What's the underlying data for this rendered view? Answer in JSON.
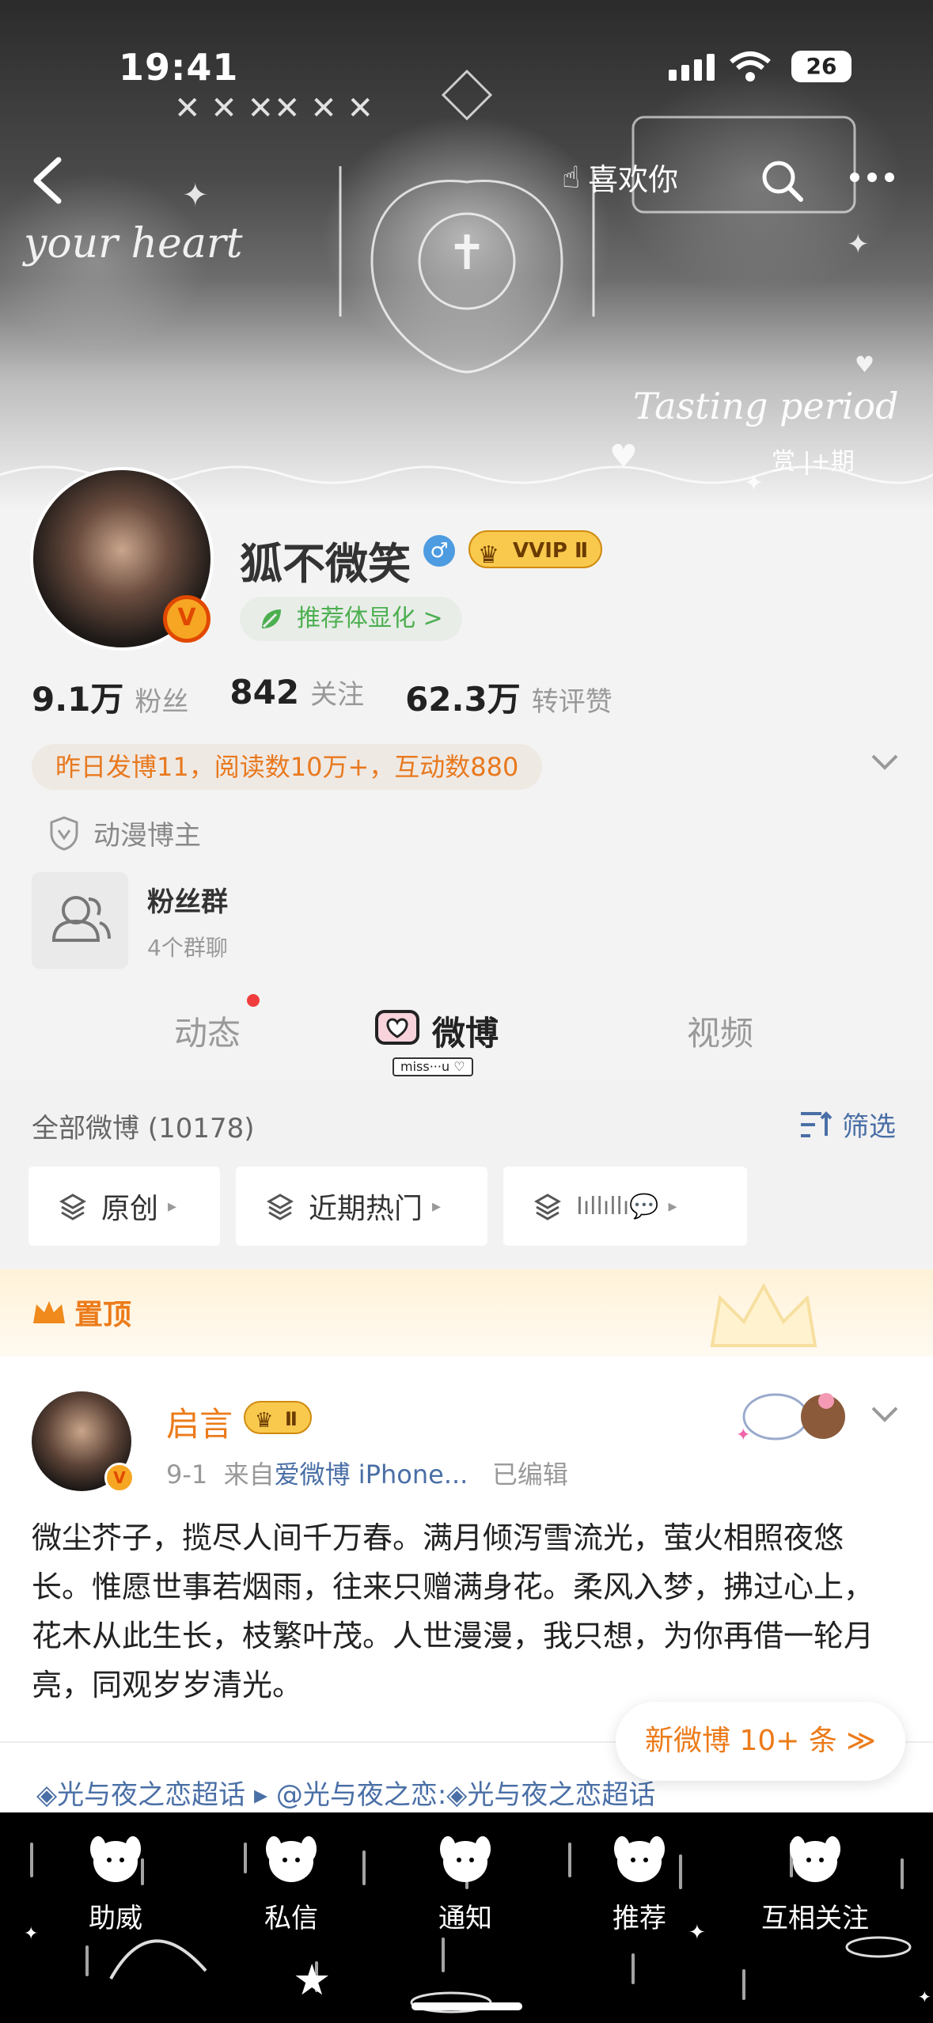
{
  "status_bar": {
    "time": "19:41",
    "battery": "26"
  },
  "header": {
    "like_label": "喜欢你",
    "banner_text_left": "your heart",
    "banner_text_right": "Tasting period",
    "banner_corner": "赏   |+期"
  },
  "profile": {
    "name": "狐不微笑",
    "gender_icon": "♂",
    "vvip": "VVIP Ⅱ",
    "recommend": "推荐体显化 >",
    "stats": [
      {
        "value": "9.1万",
        "label": "粉丝"
      },
      {
        "value": "842",
        "label": "关注"
      },
      {
        "value": "62.3万",
        "label": "转评赞"
      }
    ],
    "daily_summary": "昨日发博11，阅读数10万+，互动数880",
    "certification": "动漫博主",
    "fan_group": {
      "title": "粉丝群",
      "subtitle": "4个群聊"
    }
  },
  "tabs": [
    {
      "label": "动态",
      "active": false
    },
    {
      "label": "微博",
      "active": true
    },
    {
      "label": "视频",
      "active": false
    }
  ],
  "tab_sticker": "miss···u ♡",
  "list": {
    "all_count": "全部微博 (10178)",
    "filter_label": "筛选",
    "chips": [
      "原创",
      "近期热门",
      "Ⅰıllıllı💬"
    ]
  },
  "pinned_label": "置顶",
  "post": {
    "author": "启言",
    "badge": "Ⅱ",
    "date": "9-1",
    "source_prefix": "来自",
    "source": "爱微博 iPhone...",
    "edited": "已编辑",
    "body": "微尘芥子，揽尽人间千万春。满月倾泻雪流光，萤火相照夜悠长。惟愿世事若烟雨，往来只赠满身花。柔风入梦，拂过心上，花木从此生长，枝繁叶茂。人世漫漫，我只想，为你再借一轮月亮，同观岁岁清光。"
  },
  "new_posts_pill": "新微博 10+ 条 ≫",
  "topics": "◈光与夜之恋超话  ▸  @光与夜之恋:◈光与夜之恋超话",
  "bottom_nav": [
    "助威",
    "私信",
    "通知",
    "推荐",
    "互相关注"
  ],
  "colors": {
    "accent_orange": "#ec7b1a",
    "link_blue": "#4a6fa6",
    "vip_gold": "#f9c94e"
  }
}
